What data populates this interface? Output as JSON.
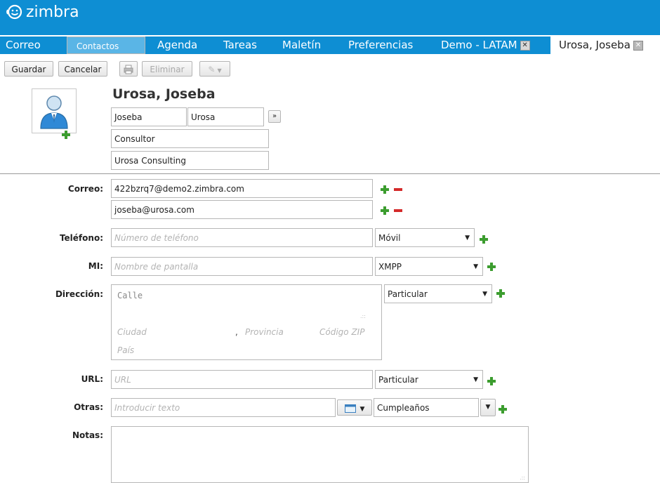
{
  "app": {
    "logo_text": "zimbra"
  },
  "tabs": [
    {
      "label": "Correo"
    },
    {
      "label": "Contactos"
    },
    {
      "label": "Agenda"
    },
    {
      "label": "Tareas"
    },
    {
      "label": "Maletín"
    },
    {
      "label": "Preferencias"
    },
    {
      "label": "Demo - LATAM"
    },
    {
      "label": "Urosa, Joseba"
    }
  ],
  "toolbar": {
    "save": "Guardar",
    "cancel": "Cancelar",
    "delete": "Eliminar"
  },
  "contact": {
    "display_name": "Urosa, Joseba",
    "first_name": "Joseba",
    "last_name": "Urosa",
    "expand": "»",
    "job_title": "Consultor",
    "company": "Urosa Consulting"
  },
  "labels": {
    "email": "Correo:",
    "phone": "Teléfono:",
    "im": "MI:",
    "address": "Dirección:",
    "url": "URL:",
    "other": "Otras:",
    "notes": "Notas:"
  },
  "emails": [
    "422bzrq7@demo2.zimbra.com",
    "joseba@urosa.com"
  ],
  "phone": {
    "placeholder": "Número de teléfono",
    "type": "Móvil"
  },
  "im": {
    "placeholder": "Nombre de pantalla",
    "type": "XMPP"
  },
  "address": {
    "street_placeholder": "Calle",
    "city_placeholder": "Ciudad",
    "state_placeholder": "Provincia",
    "zip_placeholder": "Código ZIP",
    "country_placeholder": "País",
    "comma": ",",
    "type": "Particular"
  },
  "url": {
    "placeholder": "URL",
    "type": "Particular"
  },
  "other": {
    "placeholder": "Introducir texto",
    "type": "Cumpleaños"
  },
  "colors": {
    "header": "#0e8ed3",
    "selected_tab": "#5ab5e6",
    "plus": "#3c9d2f",
    "minus": "#d42a2a"
  }
}
